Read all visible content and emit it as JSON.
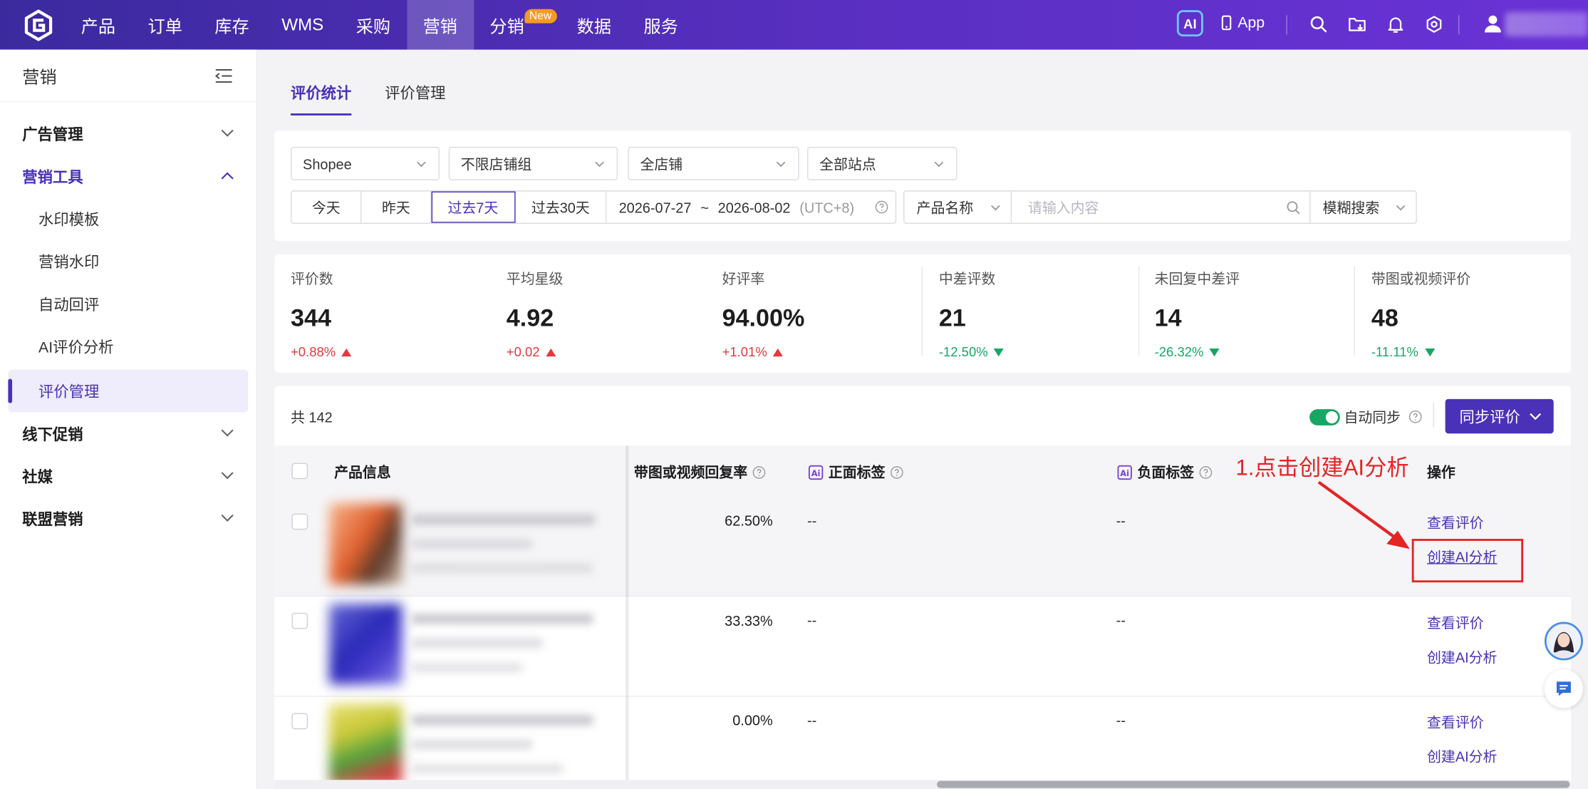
{
  "topbar": {
    "nav": [
      {
        "label": "产品"
      },
      {
        "label": "订单"
      },
      {
        "label": "库存"
      },
      {
        "label": "WMS"
      },
      {
        "label": "采购"
      },
      {
        "label": "营销"
      },
      {
        "label": "分销",
        "badge": "New"
      },
      {
        "label": "数据"
      },
      {
        "label": "服务"
      }
    ],
    "active_nav": "营销",
    "ai_label": "AI",
    "app_label": "App",
    "icons": [
      "search-icon",
      "folder-download-icon",
      "bell-icon",
      "settings-icon",
      "user-icon"
    ]
  },
  "sidebar": {
    "title": "营销",
    "groups": [
      {
        "label": "广告管理",
        "expanded": false
      },
      {
        "label": "营销工具",
        "expanded": true
      },
      {
        "label": "线下促销",
        "expanded": false
      },
      {
        "label": "社媒",
        "expanded": false
      },
      {
        "label": "联盟营销",
        "expanded": false
      }
    ],
    "tools": [
      "水印模板",
      "营销水印",
      "自动回评",
      "AI评价分析",
      "评价管理"
    ],
    "active_tool": "评价管理"
  },
  "page_tabs": [
    {
      "label": "评价统计",
      "active": true
    },
    {
      "label": "评价管理",
      "active": false
    }
  ],
  "filters": {
    "platform": "Shopee",
    "store_group": "不限店铺组",
    "store": "全店铺",
    "site": "全部站点",
    "ranges": [
      "今天",
      "昨天",
      "过去7天",
      "过去30天"
    ],
    "active_range": "过去7天",
    "date_start": "2026-07-27",
    "date_sep": "~",
    "date_end": "2026-08-02",
    "timezone": "(UTC+8)",
    "search_field": "产品名称",
    "search_placeholder": "请输入内容",
    "search_mode": "模糊搜索"
  },
  "stats": [
    {
      "label": "评价数",
      "value": "344",
      "change": "+0.88%",
      "trend": "up"
    },
    {
      "label": "平均星级",
      "value": "4.92",
      "change": "+0.02",
      "trend": "up"
    },
    {
      "label": "好评率",
      "value": "94.00%",
      "change": "+1.01%",
      "trend": "up"
    },
    {
      "label": "中差评数",
      "value": "21",
      "change": "-12.50%",
      "trend": "down"
    },
    {
      "label": "未回复中差评",
      "value": "14",
      "change": "-26.32%",
      "trend": "down"
    },
    {
      "label": "带图或视频评价",
      "value": "48",
      "change": "-11.11%",
      "trend": "down"
    }
  ],
  "table": {
    "total": "共 142",
    "auto_sync_label": "自动同步",
    "auto_sync_on": true,
    "sync_button": "同步评价",
    "columns": {
      "product": "产品信息",
      "media_rate": "带图或视频回复率",
      "positive_tags": "正面标签",
      "negative_tags": "负面标签",
      "actions": "操作"
    },
    "rows": [
      {
        "rate": "62.50%",
        "positive": "--",
        "negative": "--",
        "view": "查看评价",
        "create": "创建AI分析"
      },
      {
        "rate": "33.33%",
        "positive": "--",
        "negative": "--",
        "view": "查看评价",
        "create": "创建AI分析"
      },
      {
        "rate": "0.00%",
        "positive": "--",
        "negative": "--",
        "view": "查看评价",
        "create": "创建AI分析"
      }
    ]
  },
  "annotation": {
    "text": "1.点击创建AI分析",
    "color": "#e52424"
  },
  "colors": {
    "brand": "#4a32b8",
    "topbar_from": "#3b2a9e",
    "topbar_to": "#6a32d6",
    "up": "#e5383b",
    "down": "#17a664"
  }
}
